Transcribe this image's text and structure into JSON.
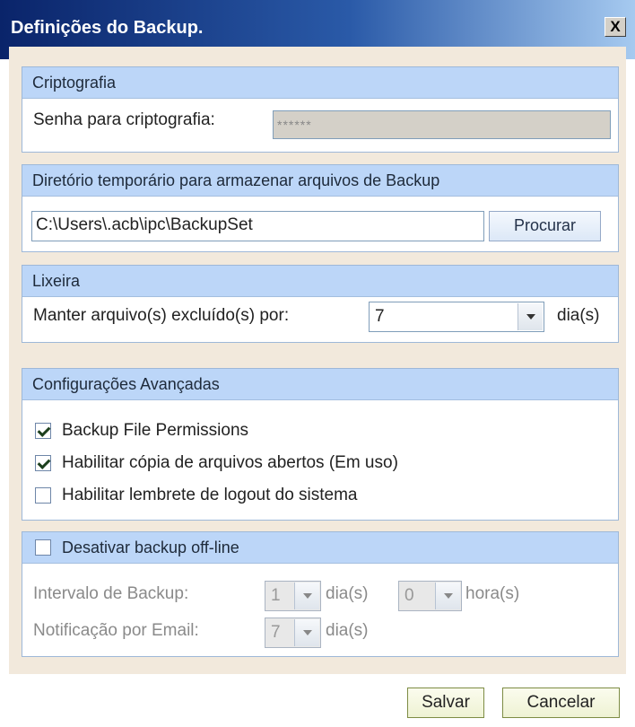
{
  "window": {
    "title": "Definições do Backup.",
    "close_label": "X"
  },
  "criptografia": {
    "header": "Criptografia",
    "password_label": "Senha para criptografia:",
    "password_value": "******"
  },
  "diretorio": {
    "header": "Diretório temporário para armazenar arquivos  de Backup",
    "path_value": "C:\\Users\\.acb\\ipc\\BackupSet",
    "browse_label": "Procurar"
  },
  "lixeira": {
    "header": "Lixeira",
    "keep_label": "Manter arquivo(s) excluído(s) por:",
    "keep_value": "7",
    "unit": "dia(s)"
  },
  "avancadas": {
    "header": "Configurações Avançadas",
    "options": [
      {
        "label": "Backup File Permissions",
        "checked": true
      },
      {
        "label": "Habilitar cópia de arquivos abertos (Em uso)",
        "checked": true
      },
      {
        "label": "Habilitar lembrete de logout do sistema",
        "checked": false
      }
    ]
  },
  "offline": {
    "header": "Desativar backup off-line",
    "checked": false,
    "interval_label": "Intervalo de Backup:",
    "interval_days_value": "1",
    "days_unit": "dia(s)",
    "interval_hours_value": "0",
    "hours_unit": "hora(s)",
    "email_label": "Notificação por Email:",
    "email_days_value": "7",
    "email_days_unit": "dia(s)"
  },
  "footer": {
    "save_label": "Salvar",
    "cancel_label": "Cancelar"
  },
  "colors": {
    "title_start": "#0a246a",
    "title_end": "#a6caf0",
    "group_header": "#bcd6f8",
    "dialog_bg": "#f2e9dc"
  }
}
